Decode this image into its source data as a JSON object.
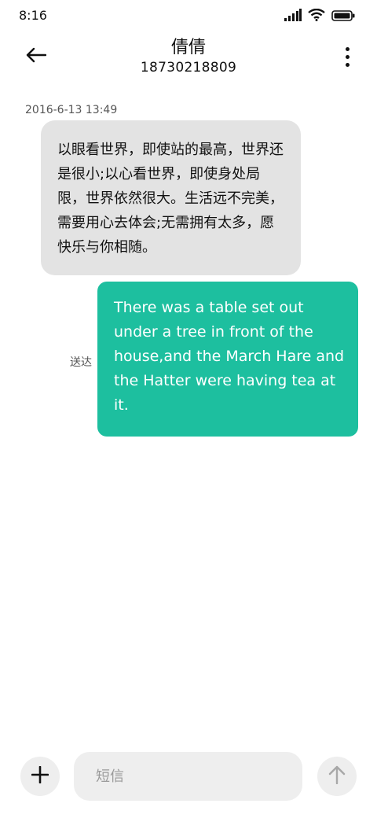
{
  "status_bar": {
    "time": "8:16",
    "icons": [
      "signal-icon",
      "wifi-icon",
      "battery-icon"
    ]
  },
  "header": {
    "back_icon": "arrow-left-icon",
    "contact_name": "倩倩",
    "contact_number": "18730218809",
    "more_icon": "more-vertical-icon"
  },
  "conversation": {
    "timestamp": "2016-6-13 13:49",
    "incoming_message": "以眼看世界，即使站的最高，世界还是很小;以心看世界，即使身处局限，世界依然很大。生活远不完美，需要用心去体会;无需拥有太多，愿快乐与你相随。",
    "outgoing_message": "There was a table set out under a tree in front of the house,and the March Hare and the Hatter were having tea at it.",
    "outgoing_status": "送达",
    "colors": {
      "incoming_bubble": "#e3e3e3",
      "outgoing_bubble": "#1dbf9f"
    }
  },
  "composer": {
    "add_icon": "plus-icon",
    "placeholder": "短信",
    "value": "",
    "send_icon": "arrow-up-icon"
  }
}
